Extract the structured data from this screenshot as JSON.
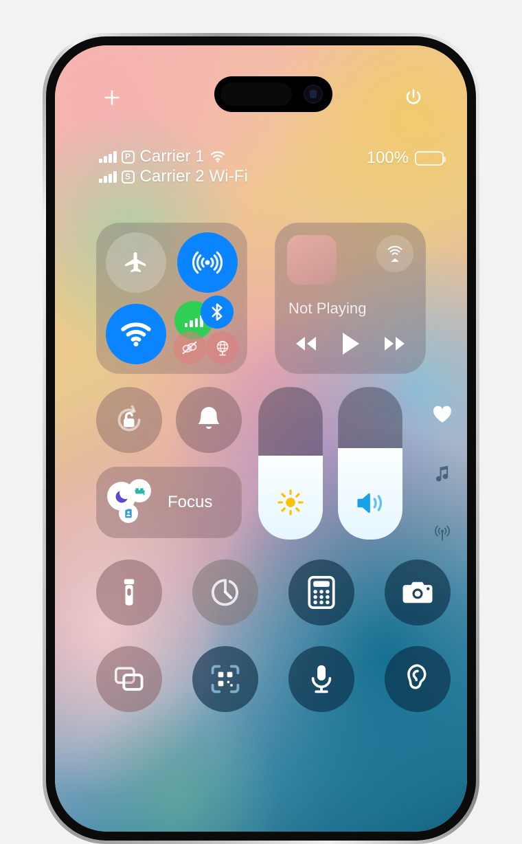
{
  "device": {
    "name": "iPhone",
    "screen_label": "Control Center"
  },
  "top_bar": {
    "add_label": "+",
    "add_icon": "plus-icon",
    "power_icon": "power-icon",
    "power_label": "Power"
  },
  "status_bar": {
    "carriers": [
      {
        "sim": "P",
        "name": "Carrier 1",
        "bars": 4,
        "trailing_icon": "wifi-icon"
      },
      {
        "sim": "S",
        "name": "Carrier 2 Wi-Fi",
        "bars": 4,
        "trailing_icon": ""
      }
    ],
    "battery": {
      "percent_label": "100%",
      "level": 100
    }
  },
  "connectivity": {
    "toggles": [
      {
        "id": "airplane",
        "label": "Airplane Mode",
        "icon": "airplane-icon",
        "state": "off"
      },
      {
        "id": "airdrop",
        "label": "AirDrop",
        "icon": "airdrop-icon",
        "state": "on"
      },
      {
        "id": "wifi",
        "label": "Wi-Fi",
        "icon": "wifi-icon",
        "state": "on"
      },
      {
        "id": "cellular",
        "label": "Cellular Data",
        "icon": "cellular-bars-icon",
        "state": "on"
      },
      {
        "id": "bluetooth",
        "label": "Bluetooth",
        "icon": "bluetooth-icon",
        "state": "on"
      },
      {
        "id": "satellite",
        "label": "Satellite",
        "icon": "satellite-slash-icon",
        "state": "unavailable"
      },
      {
        "id": "vpn",
        "label": "VPN",
        "icon": "globe-vpn-icon",
        "state": "unavailable"
      }
    ]
  },
  "media": {
    "now_playing": "Not Playing",
    "airplay_icon": "airplay-icon",
    "album_art_label": "Album Art",
    "controls": [
      {
        "id": "rewind",
        "label": "Rewind",
        "icon": "rewind-icon"
      },
      {
        "id": "play",
        "label": "Play",
        "icon": "play-icon"
      },
      {
        "id": "forward",
        "label": "Fast Forward",
        "icon": "forward-icon"
      }
    ]
  },
  "quick_toggles": {
    "rotation_lock": {
      "label": "Rotation Lock",
      "icon": "rotation-lock-icon",
      "state": "off"
    },
    "ringer": {
      "label": "Ring",
      "icon": "bell-icon",
      "state": "on"
    }
  },
  "focus": {
    "label": "Focus",
    "badges": [
      {
        "id": "do-not-disturb",
        "label": "Do Not Disturb",
        "icon": "moon-icon",
        "color": "#5a4ad1"
      },
      {
        "id": "sleep",
        "label": "Sleep",
        "icon": "bed-icon",
        "color": "#2bb3ad"
      },
      {
        "id": "work",
        "label": "Work",
        "icon": "work-badge-icon",
        "color": "#2f9bd6"
      }
    ]
  },
  "sliders": [
    {
      "id": "brightness",
      "label": "Brightness",
      "icon": "sun-icon",
      "value": 55,
      "icon_color": "#ffc107"
    },
    {
      "id": "volume",
      "label": "Volume",
      "icon": "speaker-wave-icon",
      "value": 60,
      "icon_color": "#18a0e8"
    }
  ],
  "page_rail": [
    {
      "id": "favorites",
      "label": "Favorites",
      "icon": "heart-icon",
      "active": true
    },
    {
      "id": "media-page",
      "label": "Media",
      "icon": "music-note-icon",
      "active": false
    },
    {
      "id": "connectivity-page",
      "label": "Connectivity",
      "icon": "broadcast-icon",
      "active": false
    }
  ],
  "app_shortcuts": {
    "row1": [
      {
        "id": "flashlight",
        "label": "Flashlight",
        "icon": "flashlight-icon",
        "tone": "warm"
      },
      {
        "id": "timer",
        "label": "Timer",
        "icon": "timer-icon",
        "tone": "neutral"
      },
      {
        "id": "calculator",
        "label": "Calculator",
        "icon": "calculator-icon",
        "tone": "cool"
      },
      {
        "id": "camera",
        "label": "Camera",
        "icon": "camera-icon",
        "tone": "cool"
      }
    ],
    "row2": [
      {
        "id": "screen-mirroring",
        "label": "Screen Mirroring",
        "icon": "screen-mirroring-icon",
        "tone": "warm"
      },
      {
        "id": "qr-scanner",
        "label": "Code Scanner",
        "icon": "qr-code-icon",
        "tone": "cool"
      },
      {
        "id": "voice-memo",
        "label": "Voice Memo",
        "icon": "microphone-icon",
        "tone": "cool"
      },
      {
        "id": "hearing",
        "label": "Hearing",
        "icon": "ear-icon",
        "tone": "cool"
      }
    ]
  },
  "colors": {
    "accent_blue": "#0a84ff",
    "accent_green": "#2fcf56",
    "brightness_yellow": "#ffc107",
    "volume_blue": "#18a0e8"
  }
}
